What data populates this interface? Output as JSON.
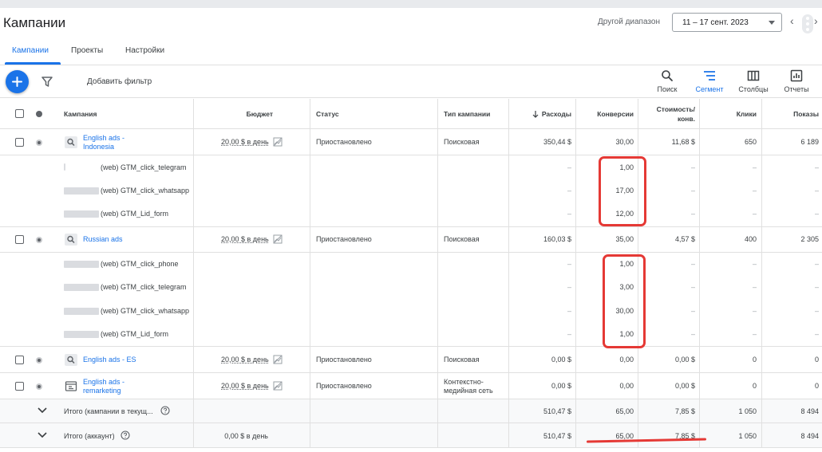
{
  "header": {
    "title": "Кампании",
    "range_label": "Другой диапазон",
    "date_range": "11 – 17 сент. 2023",
    "prev": "‹",
    "next": "›"
  },
  "tabs": [
    {
      "label": "Кампании",
      "active": true
    },
    {
      "label": "Проекты",
      "active": false
    },
    {
      "label": "Настройки",
      "active": false
    }
  ],
  "toolbar": {
    "add_filter": "Добавить фильтр",
    "search": "Поиск",
    "segment": "Сегмент",
    "columns": "Столбцы",
    "reports": "Отчеты"
  },
  "columns": {
    "campaign": "Кампания",
    "budget": "Бюджет",
    "status": "Статус",
    "type": "Тип кампании",
    "cost": "Расходы",
    "conversions": "Конверсии",
    "cost_per_conv_1": "Стоимость/",
    "cost_per_conv_2": "конв.",
    "clicks": "Клики",
    "impressions": "Показы"
  },
  "campaigns": [
    {
      "name1": "English ads -",
      "name2": "Indonesia",
      "budget": "20,00 $ в день",
      "status": "Приостановлено",
      "type1": "Поисковая",
      "type2": "",
      "cost": "350,44 $",
      "conv": "30,00",
      "cpc": "11,68 $",
      "clicks": "650",
      "impr": "6 189",
      "segments": [
        {
          "label": "(web) GTM_click_telegram",
          "cost": "–",
          "conv": "1,00",
          "cpc": "–",
          "clicks": "–",
          "impr": "–"
        },
        {
          "label": "(web) GTM_click_whatsapp",
          "cost": "–",
          "conv": "17,00",
          "cpc": "–",
          "clicks": "–",
          "impr": "–"
        },
        {
          "label": "(web) GTM_Lid_form",
          "cost": "–",
          "conv": "12,00",
          "cpc": "–",
          "clicks": "–",
          "impr": "–"
        }
      ]
    },
    {
      "name1": "Russian ads",
      "name2": "",
      "budget": "20,00 $ в день",
      "status": "Приостановлено",
      "type1": "Поисковая",
      "type2": "",
      "cost": "160,03 $",
      "conv": "35,00",
      "cpc": "4,57 $",
      "clicks": "400",
      "impr": "2 305",
      "segments": [
        {
          "label": "(web) GTM_click_phone",
          "cost": "–",
          "conv": "1,00",
          "cpc": "–",
          "clicks": "–",
          "impr": "–"
        },
        {
          "label": "(web) GTM_click_telegram",
          "cost": "–",
          "conv": "3,00",
          "cpc": "–",
          "clicks": "–",
          "impr": "–"
        },
        {
          "label": "(web) GTM_click_whatsapp",
          "cost": "–",
          "conv": "30,00",
          "cpc": "–",
          "clicks": "–",
          "impr": "–"
        },
        {
          "label": "(web) GTM_Lid_form",
          "cost": "–",
          "conv": "1,00",
          "cpc": "–",
          "clicks": "–",
          "impr": "–"
        }
      ]
    },
    {
      "name1": "English ads - ES",
      "name2": "",
      "budget": "20,00 $ в день",
      "status": "Приостановлено",
      "type1": "Поисковая",
      "type2": "",
      "cost": "0,00 $",
      "conv": "0,00",
      "cpc": "0,00 $",
      "clicks": "0",
      "impr": "0"
    },
    {
      "name1": "English ads -",
      "name2": "remarketing",
      "budget": "20,00 $ в день",
      "status": "Приостановлено",
      "type1": "Контекстно-",
      "type2": "медийная сеть",
      "cost": "0,00 $",
      "conv": "0,00",
      "cpc": "0,00 $",
      "clicks": "0",
      "impr": "0"
    }
  ],
  "totals": [
    {
      "label": "Итого (кампании в текущ...",
      "budget": "",
      "cost": "510,47 $",
      "conv": "65,00",
      "cpc": "7,85 $",
      "clicks": "1 050",
      "impr": "8 494"
    },
    {
      "label": "Итого (аккаунт)",
      "budget": "0,00 $ в день",
      "cost": "510,47 $",
      "conv": "65,00",
      "cpc": "7,85 $",
      "clicks": "1 050",
      "impr": "8 494"
    }
  ],
  "colors": {
    "accent": "#1a73e8",
    "annotation": "#e53935"
  }
}
